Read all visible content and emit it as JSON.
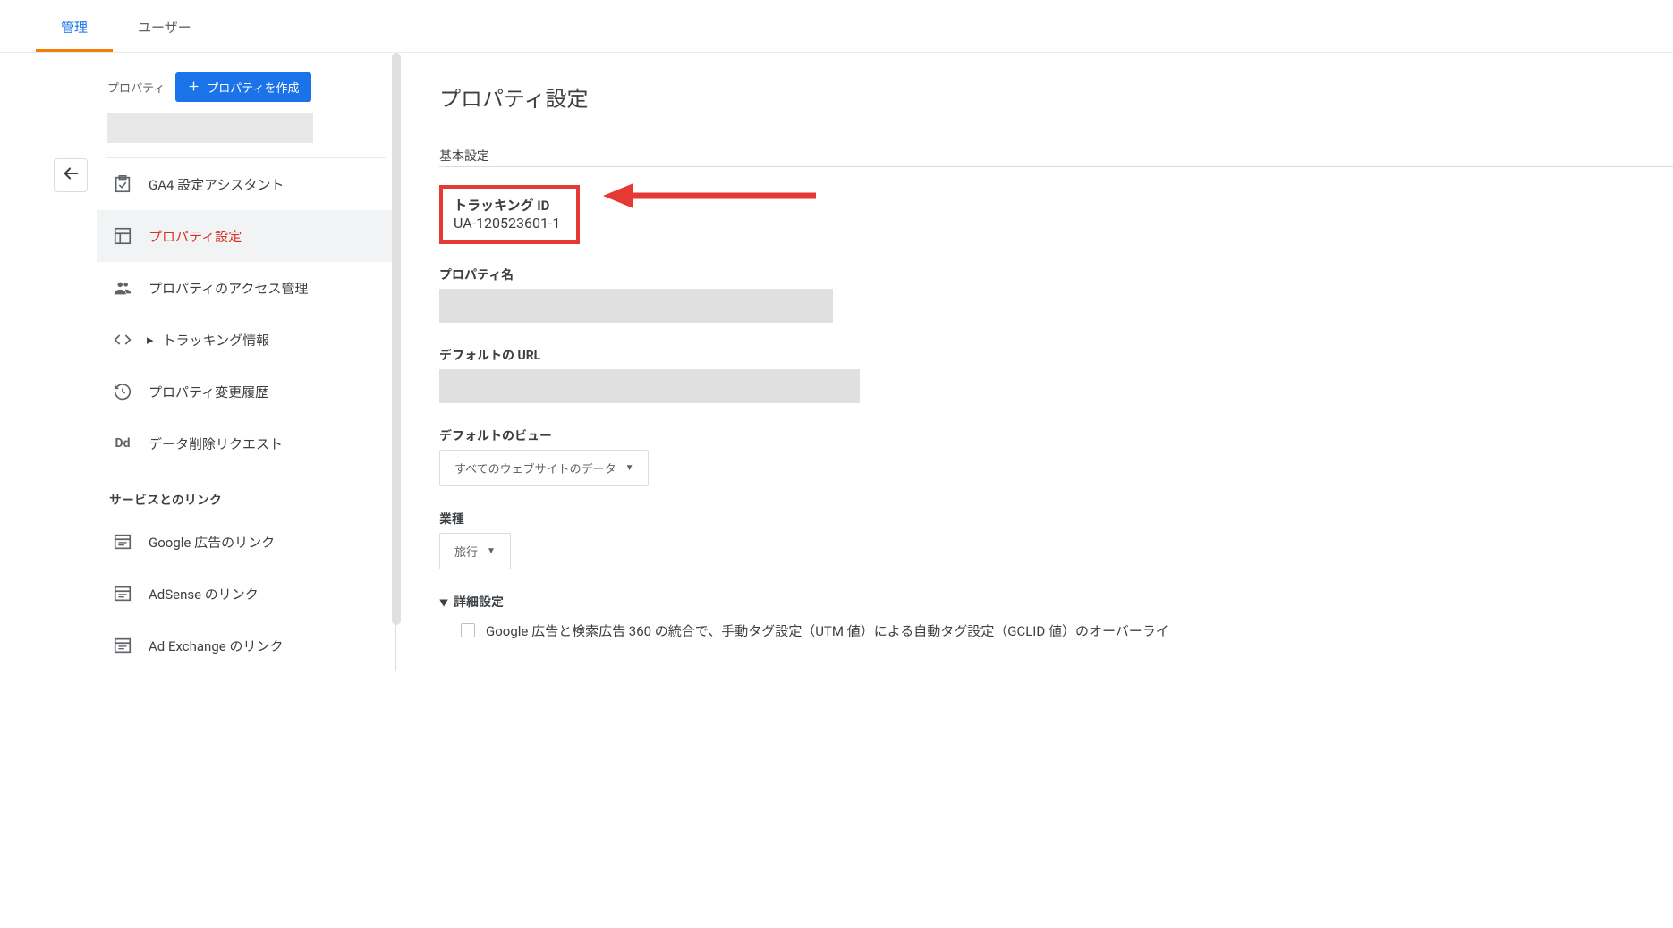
{
  "tabs": {
    "admin": "管理",
    "user": "ユーザー"
  },
  "sidebar": {
    "property_label": "プロパティ",
    "create_property": "プロパティを作成",
    "items": {
      "ga4_assistant": "GA4 設定アシスタント",
      "property_settings": "プロパティ設定",
      "access_management": "プロパティのアクセス管理",
      "tracking_info": "トラッキング情報",
      "change_history": "プロパティ変更履歴",
      "data_deletion": "データ削除リクエスト"
    },
    "section_links": "サービスとのリンク",
    "links": {
      "google_ads": "Google 広告のリンク",
      "adsense": "AdSense のリンク",
      "ad_exchange": "Ad Exchange のリンク"
    }
  },
  "main": {
    "title": "プロパティ設定",
    "basic_settings": "基本設定",
    "tracking_id_label": "トラッキング ID",
    "tracking_id_value": "UA-120523601-1",
    "property_name_label": "プロパティ名",
    "default_url_label": "デフォルトの URL",
    "default_view_label": "デフォルトのビュー",
    "default_view_value": "すべてのウェブサイトのデータ",
    "industry_label": "業種",
    "industry_value": "旅行",
    "advanced_label": "詳細設定",
    "checkbox_text": "Google 広告と検索広告 360 の統合で、手動タグ設定（UTM 値）による自動タグ設定（GCLID 値）のオーバーライ"
  }
}
